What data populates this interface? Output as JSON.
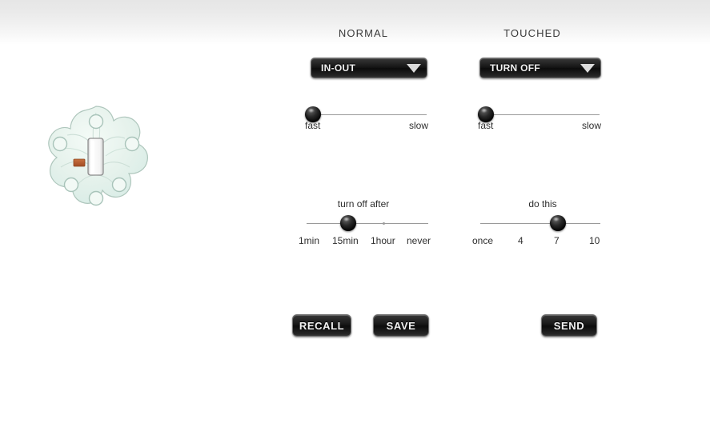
{
  "columns": {
    "normal_title": "NORMAL",
    "touched_title": "TOUCHED"
  },
  "normal": {
    "mode_dropdown": {
      "value": "IN-OUT",
      "arrow_icon": "chevron-down-icon"
    },
    "speed_slider": {
      "min_label": "fast",
      "max_label": "slow",
      "value_percent": 3
    },
    "duration_slider": {
      "caption": "turn off after",
      "ticks": [
        "1min",
        "15min",
        "1hour",
        "never"
      ],
      "value_label": "15min",
      "value_percent": 31
    }
  },
  "touched": {
    "mode_dropdown": {
      "value": "TURN OFF",
      "arrow_icon": "chevron-down-icon"
    },
    "speed_slider": {
      "min_label": "fast",
      "max_label": "slow",
      "value_percent": 3
    },
    "repeat_slider": {
      "caption": "do this",
      "ticks": [
        "once",
        "4",
        "7",
        "10"
      ],
      "value_label": "7",
      "value_percent": 62
    }
  },
  "buttons": {
    "recall": "RECALL",
    "save": "SAVE",
    "send": "SEND"
  },
  "illustration": {
    "name": "flower-switch-plate",
    "plate_color": "#e8f2ec",
    "plate_edge_color": "#b9cfc6",
    "toggle_color": "#fdfdfd",
    "screw_color": "#eaf4ef",
    "accent_color": "#b0592f"
  }
}
